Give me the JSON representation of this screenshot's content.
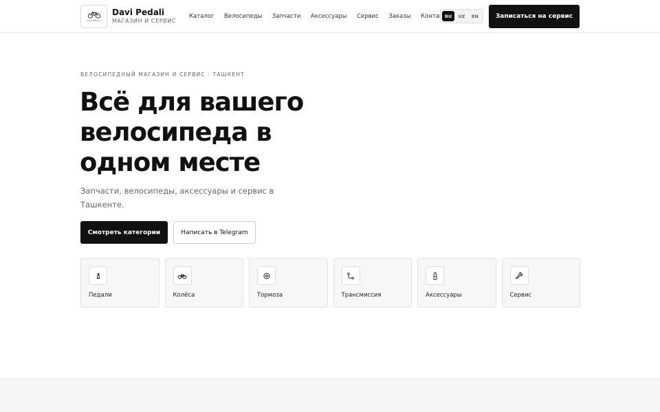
{
  "header": {
    "logo_text": "DAVI PEDALI",
    "brand_name": "Davi Pedali",
    "brand_sub": "МАГАЗИН И СЕРВИС",
    "nav": [
      "Каталог",
      "Велосипеды",
      "Запчасти",
      "Аксессуары",
      "Сервис",
      "Заказы",
      "Контакты"
    ],
    "languages": [
      "RU",
      "UZ",
      "EN"
    ],
    "active_language": "RU",
    "cta": "Записаться на сервис"
  },
  "hero": {
    "eyebrow": "ВЕЛОСИПЕДНЫЙ МАГАЗИН И СЕРВИС · ТАШКЕНТ",
    "title": "Всё для вашего велосипеда в одном месте",
    "subtitle": "Запчасти, велосипеды, аксессуары и сервис в Ташкенте.",
    "primary_button": "Смотреть категории",
    "secondary_button": "Написать в Telegram"
  },
  "categories": [
    {
      "label": "Педали",
      "icon": "pedal-icon"
    },
    {
      "label": "Колёса",
      "icon": "bicycle-icon"
    },
    {
      "label": "Тормоза",
      "icon": "brake-disc-icon"
    },
    {
      "label": "Трансмиссия",
      "icon": "derailleur-icon"
    },
    {
      "label": "Аксессуары",
      "icon": "bottle-icon"
    },
    {
      "label": "Сервис",
      "icon": "wrench-icon"
    }
  ],
  "colors": {
    "primary": "#111111",
    "background": "#ffffff",
    "card_background": "#f7f7f7",
    "muted_text": "#666666"
  }
}
